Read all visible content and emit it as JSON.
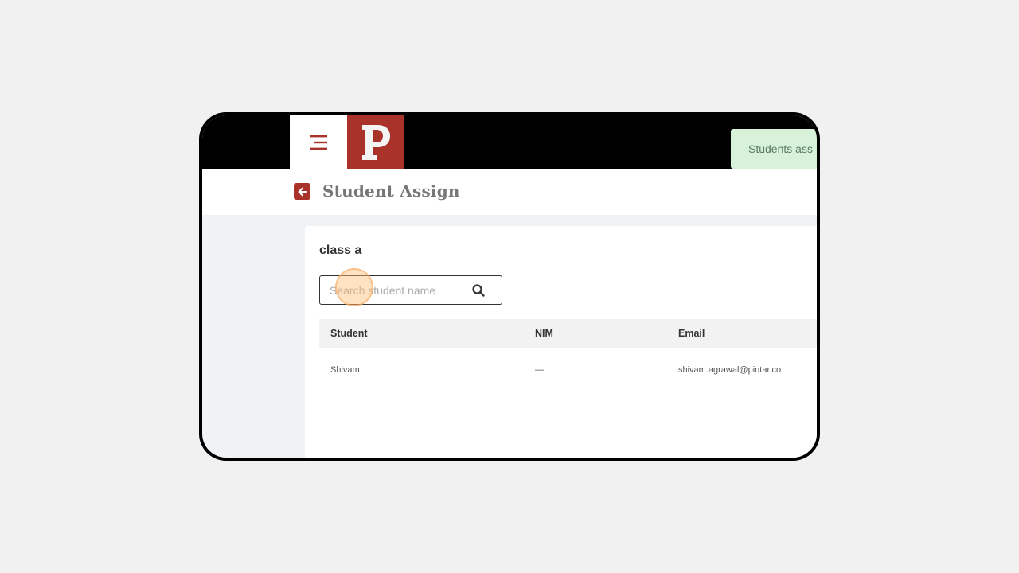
{
  "header": {
    "title": "Student Assign"
  },
  "toast": {
    "message": "Students ass"
  },
  "card": {
    "class_name": "class a",
    "search": {
      "placeholder": "Search student name",
      "value": ""
    },
    "table": {
      "columns": [
        "Student",
        "NIM",
        "Email"
      ],
      "rows": [
        {
          "student": "Shivam",
          "nim": "—",
          "email": "shivam.agrawal@pintar.co"
        }
      ]
    }
  },
  "colors": {
    "brand": "#a9322a",
    "toast_bg": "#d8f2da",
    "nav_bg": "#000000"
  },
  "icons": {
    "menu": "hamburger-menu-icon",
    "logo": "p-logo",
    "back": "arrow-left-icon",
    "search": "search-icon"
  }
}
